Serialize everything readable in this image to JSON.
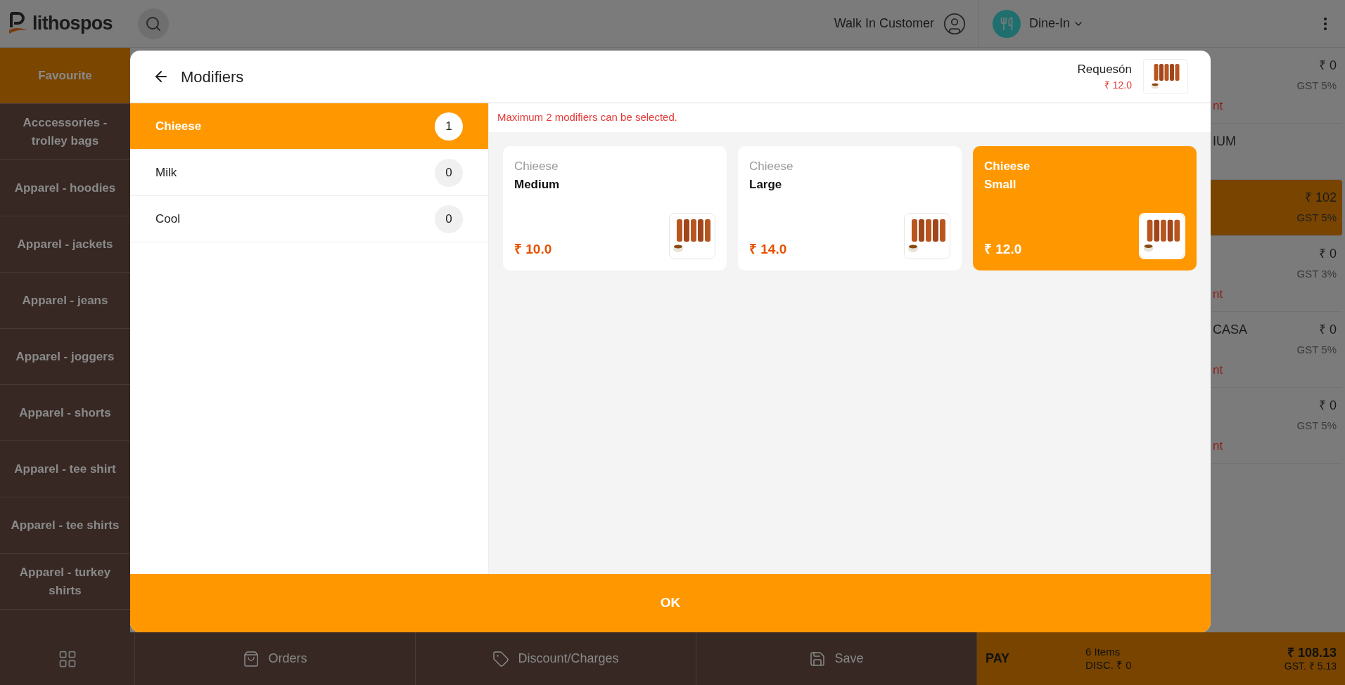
{
  "header": {
    "brand": "lithospos",
    "customer": "Walk In Customer",
    "order_type": "Dine-In"
  },
  "categories": [
    {
      "label": "Favourite",
      "selected": true
    },
    {
      "label": "Acccessories - trolley bags",
      "selected": false
    },
    {
      "label": "Apparel - hoodies",
      "selected": false
    },
    {
      "label": "Apparel - jackets",
      "selected": false
    },
    {
      "label": "Apparel - jeans",
      "selected": false
    },
    {
      "label": "Apparel - joggers",
      "selected": false
    },
    {
      "label": "Apparel - shorts",
      "selected": false
    },
    {
      "label": "Apparel - tee shirt",
      "selected": false
    },
    {
      "label": "Apparel - tee shirts",
      "selected": false
    },
    {
      "label": "Apparel - turkey shirts",
      "selected": false
    }
  ],
  "cart": [
    {
      "price": "₹ 0",
      "tax": "GST 5%",
      "note": "nt",
      "selected": false
    },
    {
      "name": "IUM",
      "selected": false
    },
    {
      "price": "₹ 102",
      "tax": "GST 5%",
      "selected": true
    },
    {
      "price": "₹ 0",
      "tax": "GST 3%",
      "note": "nt",
      "selected": false
    },
    {
      "name": "CASA",
      "price": "₹ 0",
      "tax": "GST 5%",
      "note": "nt",
      "selected": false
    },
    {
      "price": "₹ 0",
      "tax": "GST 5%",
      "note": "nt",
      "selected": false
    }
  ],
  "modal": {
    "title": "Modifiers",
    "item": {
      "name": "Requesón",
      "price": "₹ 12.0"
    },
    "groups": [
      {
        "name": "Chieese",
        "count": "1",
        "selected": true
      },
      {
        "name": "Milk",
        "count": "0",
        "selected": false
      },
      {
        "name": "Cool",
        "count": "0",
        "selected": false
      }
    ],
    "notice": "Maximum 2 modifiers can be selected.",
    "options": [
      {
        "group": "Chieese",
        "name": "Medium",
        "price": "₹ 10.0",
        "selected": false
      },
      {
        "group": "Chieese",
        "name": "Large",
        "price": "₹ 14.0",
        "selected": false
      },
      {
        "group": "Chieese",
        "name": "Small",
        "price": "₹ 12.0",
        "selected": true
      }
    ],
    "confirm": "OK"
  },
  "footer": {
    "actions": [
      "Orders",
      "Discount/Charges",
      "Save"
    ],
    "pay": {
      "label": "PAY",
      "items": "6 Items",
      "discount": "DISC. ₹ 0",
      "total": "₹ 108.13",
      "tax": "GST. ₹ 5.13"
    }
  }
}
